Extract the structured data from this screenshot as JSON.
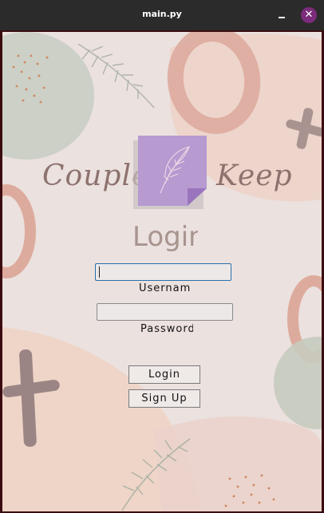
{
  "window": {
    "title": "main.py",
    "minimize_symbol": "",
    "close_symbol": "✕"
  },
  "brand": {
    "left_text": "Couple",
    "right_text": "Keep",
    "logo_icon": "feather-note-icon"
  },
  "form": {
    "heading": "Login",
    "username_label": "Username",
    "username_value": "",
    "password_label": "Password",
    "password_value": "",
    "login_button": "Login",
    "signup_button": "Sign Up"
  },
  "colors": {
    "titlebar": "#2b2b2b",
    "close_button": "#7b2c7a",
    "background": "#ebe1df",
    "logo": "#b79ad0",
    "accent_focus": "#2a6fa8"
  }
}
